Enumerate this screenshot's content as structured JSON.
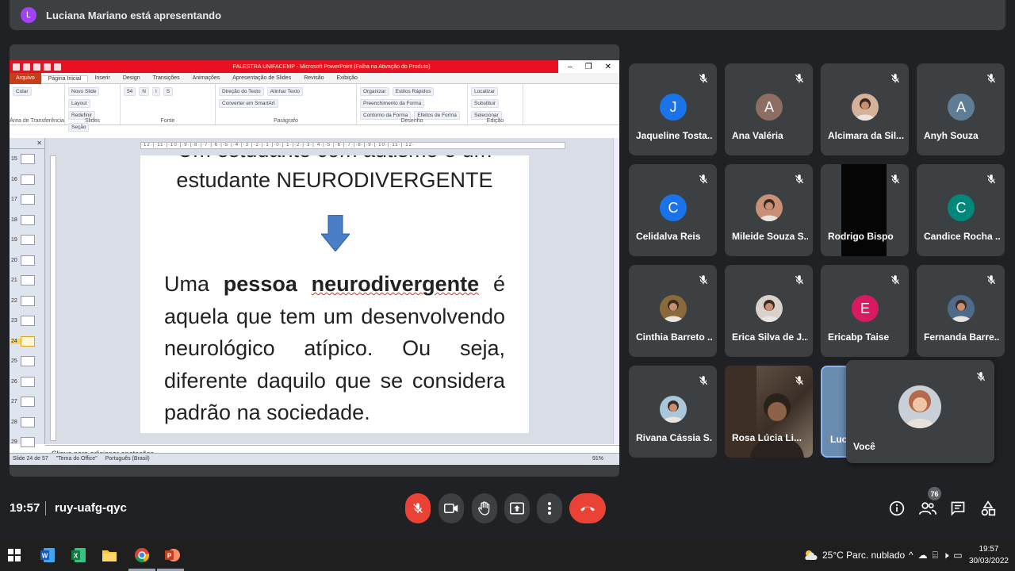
{
  "banner": {
    "avatar_letter": "L",
    "text": "Luciana Mariano está apresentando"
  },
  "ppt": {
    "window_title": "PALESTRA UNIFACEMP - Microsoft PowerPoint (Falha na Ativação do Produto)",
    "tabs": [
      "Arquivo",
      "Página Inicial",
      "Inserir",
      "Design",
      "Transições",
      "Animações",
      "Apresentação de Slides",
      "Revisão",
      "Exibição"
    ],
    "ribbon_groups": [
      {
        "label": "Área de Transferência",
        "buttons": [
          "Colar"
        ]
      },
      {
        "label": "Slides",
        "buttons": [
          "Novo Slide",
          "Layout",
          "Redefinir",
          "Seção"
        ]
      },
      {
        "label": "Fonte",
        "buttons": [
          "54",
          "N",
          "I",
          "S"
        ]
      },
      {
        "label": "Parágrafo",
        "buttons": [
          "Direção do Texto",
          "Alinhar Texto",
          "Converter em SmartArt"
        ]
      },
      {
        "label": "Desenho",
        "buttons": [
          "Organizar",
          "Estilos Rápidos",
          "Preenchimento da Forma",
          "Contorno da Forma",
          "Efeitos de Forma"
        ]
      },
      {
        "label": "Edição",
        "buttons": [
          "Localizar",
          "Substituir",
          "Selecionar"
        ]
      }
    ],
    "ruler": "·12·|·11·|·10·|·9·|·8·|·7·|·6·|·5·|·4·|·3·|·2·|·1·|·0·|·1·|·2·|·3·|·4·|·5·|·6·|·7·|·8·|·9·|·10·|·11·|·12·",
    "thumbnails": [
      "15",
      "16",
      "17",
      "18",
      "19",
      "20",
      "21",
      "22",
      "23",
      "24",
      "25",
      "26",
      "27",
      "28",
      "29"
    ],
    "selected_thumbnail": "24",
    "slide": {
      "line1": "Um estudante com autismo é um",
      "line2": "estudante NEURODIVERGENTE",
      "para_pre": "Uma ",
      "para_b1": "pessoa",
      "para_b2": "neurodivergente",
      "para_post": " é aquela que tem um desenvolvendo neurológico atípico. Ou seja, diferente daquilo que se considera padrão na sociedade."
    },
    "notes_placeholder": "Clique para adicionar anotações",
    "status": {
      "slide": "Slide 24 de 57",
      "theme": "\"Tema do Office\"",
      "language": "Português (Brasil)",
      "zoom": "91%"
    }
  },
  "participants": [
    {
      "name": "Jaqueline Tosta...",
      "letter": "J",
      "color": "#1a73e8"
    },
    {
      "name": "Ana Valéria",
      "letter": "A",
      "color": "#8d6e63"
    },
    {
      "name": "Alcimara da Sil...",
      "letter": "",
      "color": "#d7b29a"
    },
    {
      "name": "Anyh Souza",
      "letter": "A",
      "color": "#5f7d95"
    },
    {
      "name": "Celidalva Reis",
      "letter": "C",
      "color": "#1a73e8"
    },
    {
      "name": "Mileide Souza S...",
      "letter": "",
      "color": "#c98f77"
    },
    {
      "name": "Rodrigo Bispo",
      "letter": "",
      "color": "#000000"
    },
    {
      "name": "Candice Rocha ...",
      "letter": "C",
      "color": "#00897b"
    },
    {
      "name": "Cinthia Barreto ...",
      "letter": "",
      "color": "#8a6a3a"
    },
    {
      "name": "Erica Silva de J...",
      "letter": "",
      "color": "#d9d2cc"
    },
    {
      "name": "Ericabp Taise",
      "letter": "E",
      "color": "#d81b60"
    },
    {
      "name": "Fernanda Barre...",
      "letter": "",
      "color": "#4f6b8a"
    },
    {
      "name": "Rivana Cássia S...",
      "letter": "",
      "color": "#a9c7d8"
    },
    {
      "name": "Rosa Lúcia Li...",
      "letter": "",
      "color": "#5b4a3f"
    }
  ],
  "partial_tile_name": "Luc",
  "self_tile_name": "Você",
  "meet": {
    "time": "19:57",
    "code": "ruy-uafg-qyc",
    "participant_count": "76"
  },
  "taskbar": {
    "weather": "25°C  Parc. nublado",
    "clock_time": "19:57",
    "clock_date": "30/03/2022"
  }
}
